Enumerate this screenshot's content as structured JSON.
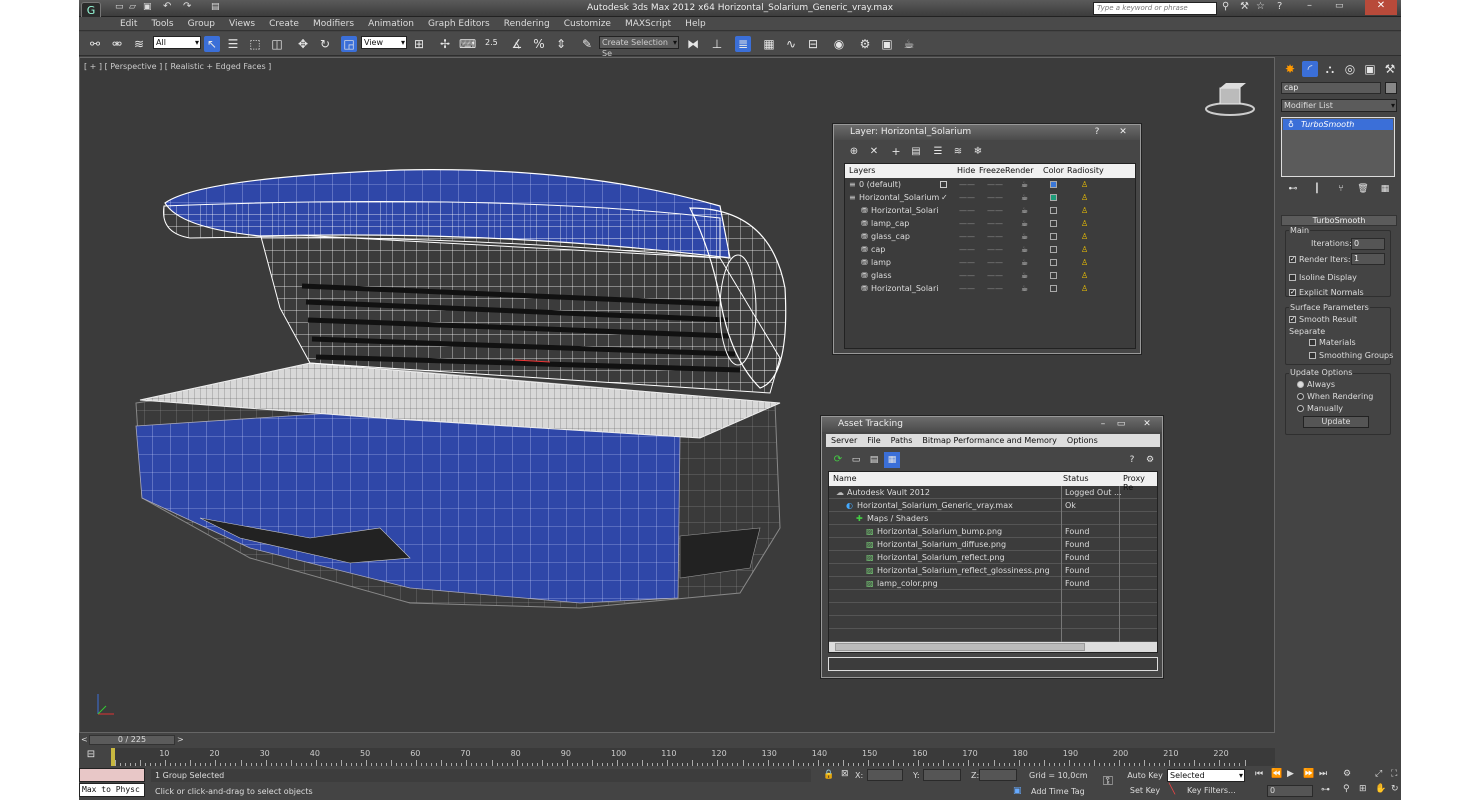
{
  "window": {
    "title": "Autodesk 3ds Max  2012 x64      Horizontal_Solarium_Generic_vray.max",
    "search_placeholder": "Type a keyword or phrase"
  },
  "menu": [
    "Edit",
    "Tools",
    "Group",
    "Views",
    "Create",
    "Modifiers",
    "Animation",
    "Graph Editors",
    "Rendering",
    "Customize",
    "MAXScript",
    "Help"
  ],
  "toolbar": {
    "filter": "All",
    "refcoord": "View",
    "selection_set": "Create Selection Se",
    "snap_label": "2.5"
  },
  "viewport": {
    "label": "[ + ] [ Perspective ] [ Realistic + Edged Faces ]"
  },
  "layer_dialog": {
    "title": "Layer: Horizontal_Solarium",
    "columns": [
      "Layers",
      "Hide",
      "Freeze",
      "Render",
      "Color",
      "Radiosity"
    ],
    "rows": [
      {
        "name": "0 (default)",
        "level": 0,
        "color": "#3b78d8"
      },
      {
        "name": "Horizontal_Solarium",
        "level": 0,
        "color": "#1e9c7a",
        "current": "✓"
      },
      {
        "name": "Horizontal_Solari",
        "level": 1,
        "color": "#3c3c3c"
      },
      {
        "name": "lamp_cap",
        "level": 1,
        "color": "#3c3c3c"
      },
      {
        "name": "glass_cap",
        "level": 1,
        "color": "#3c3c3c"
      },
      {
        "name": "cap",
        "level": 1,
        "color": "#3c3c3c"
      },
      {
        "name": "lamp",
        "level": 1,
        "color": "#3c3c3c"
      },
      {
        "name": "glass",
        "level": 1,
        "color": "#3c3c3c"
      },
      {
        "name": "Horizontal_Solari",
        "level": 1,
        "color": "#3c3c3c"
      }
    ],
    "hide_dash": "——"
  },
  "asset_dialog": {
    "title": "Asset Tracking",
    "menu": [
      "Server",
      "File",
      "Paths",
      "Bitmap Performance and Memory",
      "Options"
    ],
    "columns": [
      "Name",
      "Status",
      "Proxy Re"
    ],
    "rows": [
      {
        "name": "Autodesk Vault 2012",
        "status": "Logged Out ...",
        "level": 0
      },
      {
        "name": "Horizontal_Solarium_Generic_vray.max",
        "status": "Ok",
        "level": 1
      },
      {
        "name": "Maps / Shaders",
        "status": "",
        "level": 2
      },
      {
        "name": "Horizontal_Solarium_bump.png",
        "status": "Found",
        "level": 3
      },
      {
        "name": "Horizontal_Solarium_diffuse.png",
        "status": "Found",
        "level": 3
      },
      {
        "name": "Horizontal_Solarium_reflect.png",
        "status": "Found",
        "level": 3
      },
      {
        "name": "Horizontal_Solarium_reflect_glossiness.png",
        "status": "Found",
        "level": 3
      },
      {
        "name": "lamp_color.png",
        "status": "Found",
        "level": 3
      }
    ]
  },
  "command_panel": {
    "object_name": "cap",
    "modifier_list": "Modifier List",
    "stack_item": "TurboSmooth",
    "rollout_title": "TurboSmooth",
    "main_label": "Main",
    "iterations_label": "Iterations:",
    "iterations_value": "0",
    "render_iters_label": "Render Iters:",
    "render_iters_value": "1",
    "isoline": "Isoline Display",
    "explicit_normals": "Explicit Normals",
    "surface_params": "Surface Parameters",
    "smooth_result": "Smooth Result",
    "separate": "Separate",
    "materials": "Materials",
    "smoothing_groups": "Smoothing Groups",
    "update_options": "Update Options",
    "always": "Always",
    "when_rendering": "When Rendering",
    "manually": "Manually",
    "update_button": "Update"
  },
  "timeline": {
    "frame": "0 / 225",
    "ticks": [
      "10",
      "20",
      "30",
      "40",
      "50",
      "60",
      "70",
      "80",
      "90",
      "100",
      "110",
      "120",
      "130",
      "140",
      "150",
      "160",
      "170",
      "180",
      "190",
      "200",
      "210",
      "220"
    ]
  },
  "status": {
    "maxscript": "Max to Physc",
    "selected": "1 Group Selected",
    "prompt": "Click or click-and-drag to select objects",
    "x_label": "X:",
    "y_label": "Y:",
    "z_label": "Z:",
    "grid": "Grid = 10,0cm",
    "add_time_tag": "Add Time Tag",
    "auto_key": "Auto Key",
    "set_key": "Set Key",
    "key_mode": "Selected",
    "key_filters": "Key Filters...",
    "current_frame": "0"
  },
  "colors": {
    "mesh_blue": "#2f47a8",
    "wire": "#ffffff",
    "accent": "#3b6fd8"
  }
}
